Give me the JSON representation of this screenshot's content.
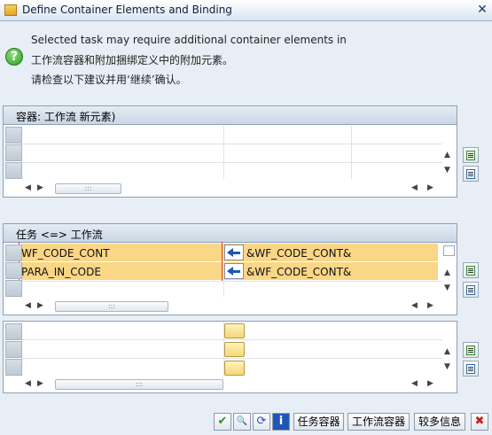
{
  "window": {
    "title": "Define Container Elements and Binding",
    "close_glyph": "✕"
  },
  "message": {
    "icon": "question-icon",
    "icon_glyph": "?",
    "line1": "Selected task may require additional container elements in",
    "line2": "工作流容器和附加捆绑定义中的附加元素。",
    "line3": "请检查以下建议并用‘继续’确认。"
  },
  "panel1": {
    "header": "容器: 工作流 新元素)",
    "rows": [
      "",
      "",
      ""
    ]
  },
  "panel2": {
    "header": "任务 <=> 工作流",
    "rows": [
      {
        "task_element": "WF_CODE_CONT",
        "workflow_element": "&WF_CODE_CONT&"
      },
      {
        "task_element": "PARA_IN_CODE",
        "workflow_element": "&WF_CODE_CONT&"
      },
      {
        "task_element": "",
        "workflow_element": ""
      }
    ]
  },
  "panel3": {
    "rows": [
      "",
      "",
      ""
    ]
  },
  "scroll": {
    "left": "◀",
    "right": "▶",
    "up": "▲",
    "down": "▼",
    "grip": ":::"
  },
  "toolbar": {
    "confirm_icon": "✔",
    "find_icon": "🔍",
    "refresh_icon": "⟳",
    "info_icon": "i",
    "task_container": "任务容器",
    "workflow_container": "工作流容器",
    "more_info": "较多信息",
    "cancel_icon": "✖"
  },
  "colors": {
    "highlight_row": "#fad687",
    "arrow_blue": "#1e57b8",
    "confirm_green": "#2e8a2e",
    "cancel_red": "#c8201c"
  }
}
